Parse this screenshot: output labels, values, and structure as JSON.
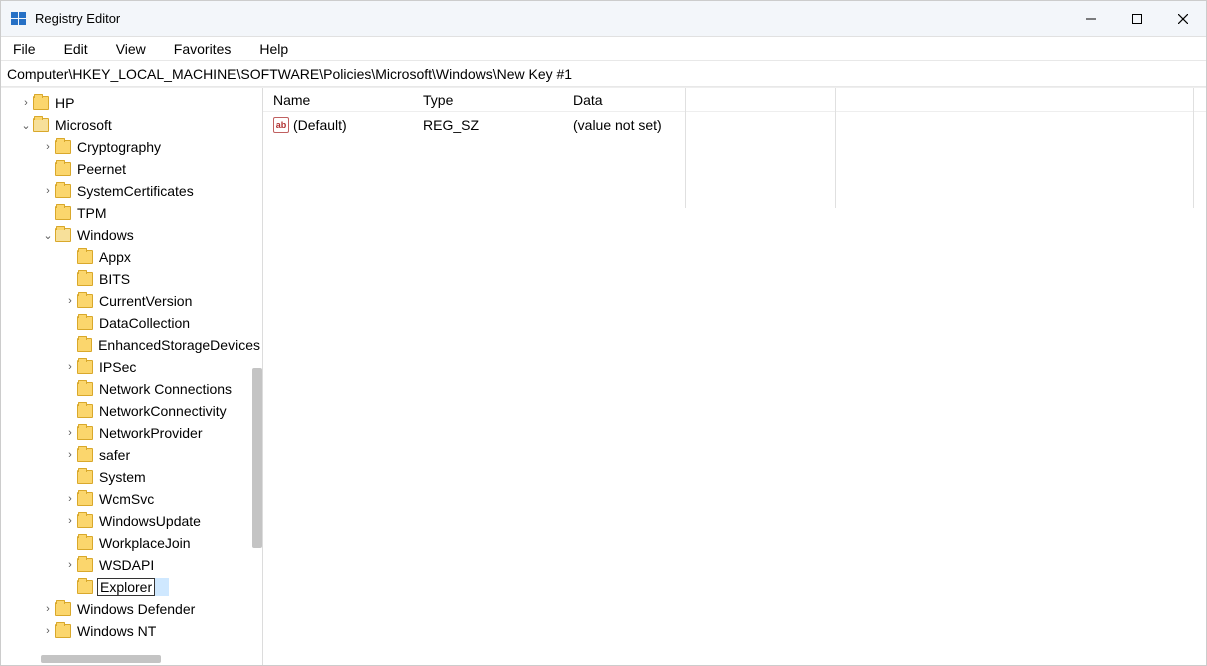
{
  "title": "Registry Editor",
  "menubar": [
    "File",
    "Edit",
    "View",
    "Favorites",
    "Help"
  ],
  "address": "Computer\\HKEY_LOCAL_MACHINE\\SOFTWARE\\Policies\\Microsoft\\Windows\\New Key #1",
  "tree": {
    "hp": "HP",
    "microsoft": "Microsoft",
    "cryptography": "Cryptography",
    "peernet": "Peernet",
    "systemcertificates": "SystemCertificates",
    "tpm": "TPM",
    "windows": "Windows",
    "appx": "Appx",
    "bits": "BITS",
    "currentversion": "CurrentVersion",
    "datacollection": "DataCollection",
    "enhancedstoragedevices": "EnhancedStorageDevices",
    "ipsec": "IPSec",
    "network_connections": "Network Connections",
    "networkconnectivity": "NetworkConnectivity",
    "networkprovider": "NetworkProvider",
    "safer": "safer",
    "system": "System",
    "wcmsvc": "WcmSvc",
    "windowsupdate": "WindowsUpdate",
    "workplacejoin": "WorkplaceJoin",
    "wsdapi": "WSDAPI",
    "explorer_edit": "Explorer",
    "windows_defender": "Windows Defender",
    "windows_nt": "Windows NT"
  },
  "list": {
    "headers": {
      "name": "Name",
      "type": "Type",
      "data": "Data"
    },
    "rows": [
      {
        "name": "(Default)",
        "type": "REG_SZ",
        "data": "(value not set)"
      }
    ]
  },
  "icons": {
    "string_value": "ab"
  }
}
